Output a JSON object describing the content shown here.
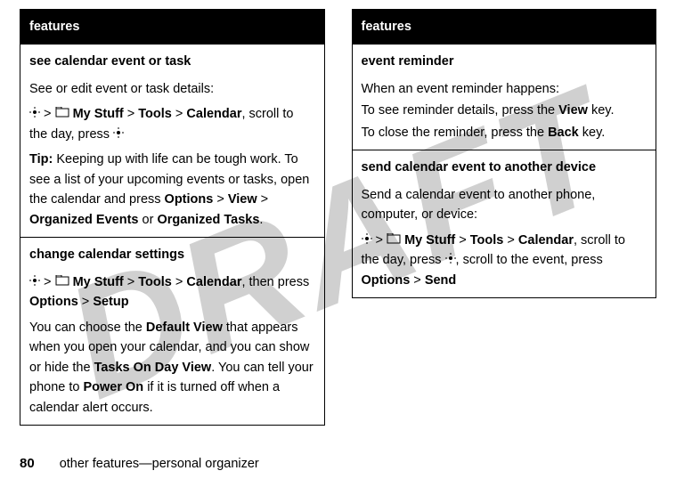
{
  "watermark": "DRAFT",
  "left": {
    "header": "features",
    "sections": [
      {
        "title": "see calendar event or task",
        "para1": "See or edit event or task details:",
        "nav_pre": " > ",
        "nav_mystuff": "My Stuff",
        "nav_gt1": " > ",
        "nav_tools": "Tools",
        "nav_gt2": " > ",
        "nav_calendar": "Calendar",
        "nav_post": ", scroll to the day, press ",
        "tip_label": "Tip:",
        "tip_text": " Keeping up with life can be tough work. To see a list of your upcoming events or tasks, open the calendar and press ",
        "tip_options": "Options",
        "tip_gt1": " > ",
        "tip_view": "View",
        "tip_gt2": " > ",
        "tip_org_events": "Organized Events",
        "tip_or": " or ",
        "tip_org_tasks": "Organized Tasks",
        "tip_period": "."
      },
      {
        "title": "change calendar settings",
        "nav_pre": " > ",
        "nav_mystuff": "My Stuff",
        "nav_gt1": " > ",
        "nav_tools": "Tools",
        "nav_gt2": " > ",
        "nav_calendar": "Calendar",
        "nav_post": ", then press ",
        "nav_options": "Options",
        "nav_gt3": " > ",
        "nav_setup": "Setup",
        "body_pre": "You can choose the ",
        "body_defview": "Default View",
        "body_mid1": " that appears when you open your calendar, and you can show or hide the ",
        "body_tasks": "Tasks On Day View",
        "body_mid2": ". You can tell your phone to ",
        "body_poweron": "Power On",
        "body_post": " if it is turned off when a calendar alert occurs."
      }
    ]
  },
  "right": {
    "header": "features",
    "sections": [
      {
        "title": "event reminder",
        "line1": "When an event reminder happens:",
        "line2_pre": "To see reminder details, press the ",
        "line2_key": "View",
        "line2_post": " key.",
        "line3_pre": "To close the reminder, press the ",
        "line3_key": "Back",
        "line3_post": " key."
      },
      {
        "title": "send calendar event to another device",
        "para1": "Send a calendar event to another phone, computer, or device:",
        "nav_pre": " > ",
        "nav_mystuff": "My Stuff",
        "nav_gt1": " > ",
        "nav_tools": "Tools",
        "nav_gt2": " > ",
        "nav_calendar": "Calendar",
        "nav_post1": ", scroll to the day, press ",
        "nav_post2": ", scroll to the event, press ",
        "nav_options": "Options",
        "nav_gt3": " > ",
        "nav_send": "Send"
      }
    ]
  },
  "footer": {
    "page": "80",
    "text": "other features—personal organizer"
  }
}
